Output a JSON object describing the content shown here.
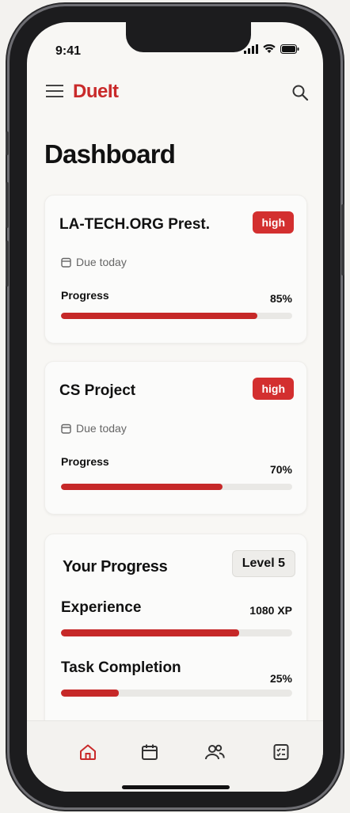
{
  "status": {
    "time": "9:41"
  },
  "header": {
    "brand": "DueIt",
    "menu_icon": "menu-icon",
    "search_icon": "search-icon"
  },
  "page": {
    "title": "Dashboard"
  },
  "tasks": [
    {
      "title": "LA-TECH.ORG Prest.",
      "priority": "high",
      "due": "Due today",
      "progress_label": "Progress",
      "progress_text": "85%",
      "progress": 0.85
    },
    {
      "title": "CS Project",
      "priority": "high",
      "due": "Due today",
      "progress_label": "Progress",
      "progress_text": "70%",
      "progress": 0.7
    }
  ],
  "your_progress": {
    "title": "Your Progress",
    "level": "Level 5",
    "experience": {
      "label": "Experience",
      "value": "1080 XP",
      "fill": 0.77
    },
    "task_completion": {
      "label": "Task Completion",
      "value": "25%",
      "fill": 0.25
    }
  },
  "nav": {
    "items": [
      "home-icon",
      "calendar-icon",
      "users-icon",
      "checklist-icon"
    ],
    "active": "home-icon"
  },
  "colors": {
    "accent": "#c92a2a",
    "bar_bg": "#e9e8e5",
    "background": "#f8f7f4"
  }
}
